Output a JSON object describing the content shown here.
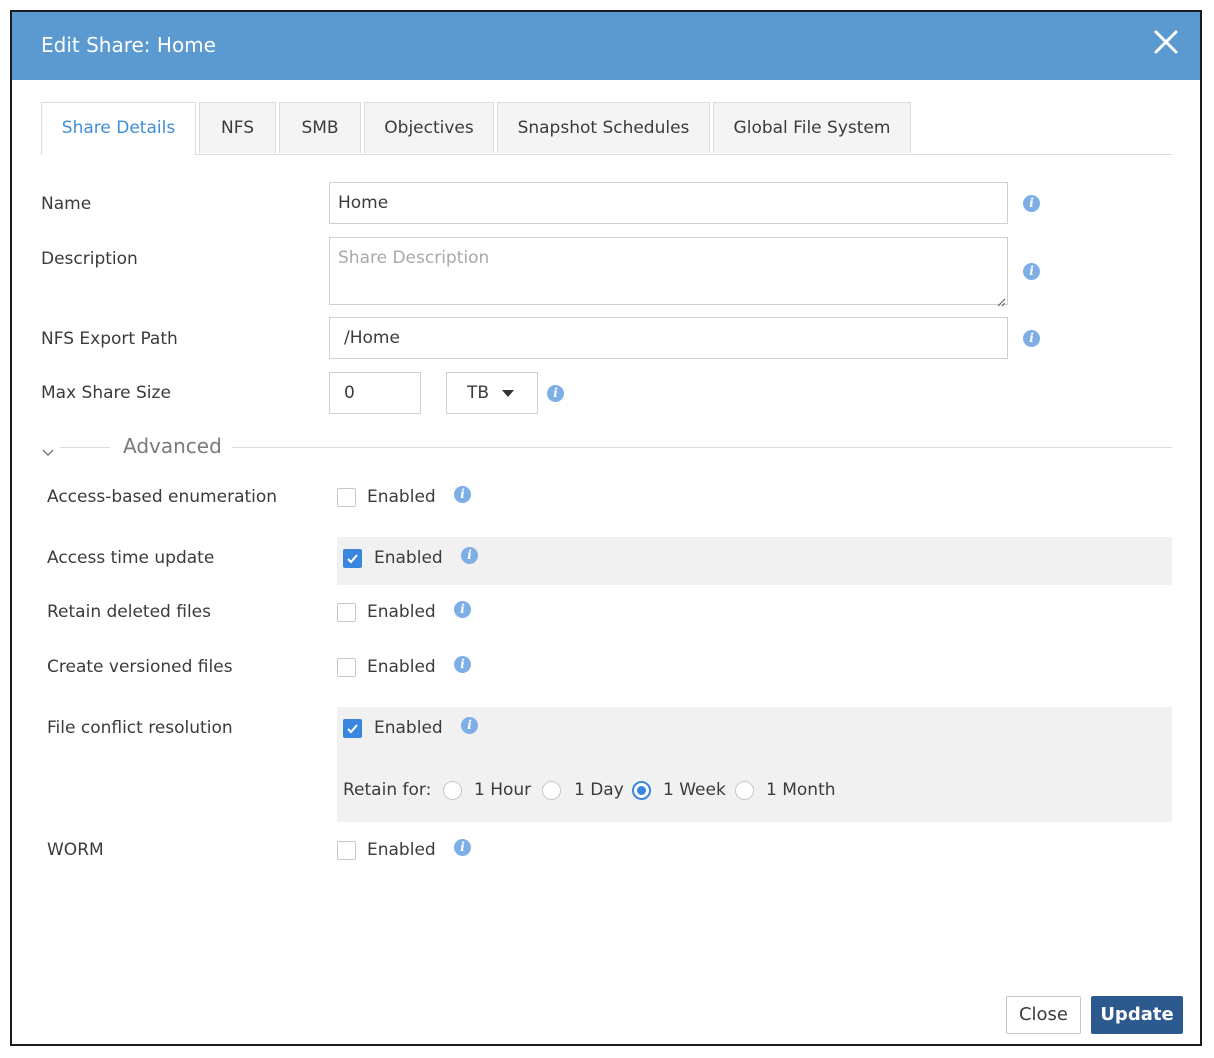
{
  "dialog": {
    "title": "Edit Share: Home"
  },
  "tabs": [
    {
      "label": "Share Details",
      "active": true
    },
    {
      "label": "NFS",
      "active": false
    },
    {
      "label": "SMB",
      "active": false
    },
    {
      "label": "Objectives",
      "active": false
    },
    {
      "label": "Snapshot Schedules",
      "active": false
    },
    {
      "label": "Global File System",
      "active": false
    }
  ],
  "form": {
    "name_label": "Name",
    "name_value": "Home",
    "description_label": "Description",
    "description_placeholder": "Share Description",
    "nfs_path_label": "NFS Export Path",
    "nfs_path_value": "/Home",
    "max_size_label": "Max Share Size",
    "max_size_value": "0",
    "max_size_unit": "TB"
  },
  "advanced": {
    "title": "Advanced",
    "enabled_label": "Enabled",
    "options": [
      {
        "label": "Access-based enumeration",
        "checked": false
      },
      {
        "label": "Access time update",
        "checked": true
      },
      {
        "label": "Retain deleted files",
        "checked": false
      },
      {
        "label": "Create versioned files",
        "checked": false
      },
      {
        "label": "File conflict resolution",
        "checked": true
      },
      {
        "label": "WORM",
        "checked": false
      }
    ],
    "retain_for": {
      "label": "Retain for:",
      "options": [
        "1 Hour",
        "1 Day",
        "1 Week",
        "1 Month"
      ],
      "selected": "1 Week"
    }
  },
  "footer": {
    "close_label": "Close",
    "update_label": "Update"
  },
  "colors": {
    "titlebar": "#5b99d1",
    "accent": "#3a86de",
    "primary_button": "#2d5a8e",
    "active_tab_text": "#3f8ed6"
  },
  "icons": {
    "close": "close-icon",
    "info": "info-icon",
    "caret": "caret-down-icon",
    "chevron": "chevron-down-icon",
    "check": "check-icon"
  }
}
